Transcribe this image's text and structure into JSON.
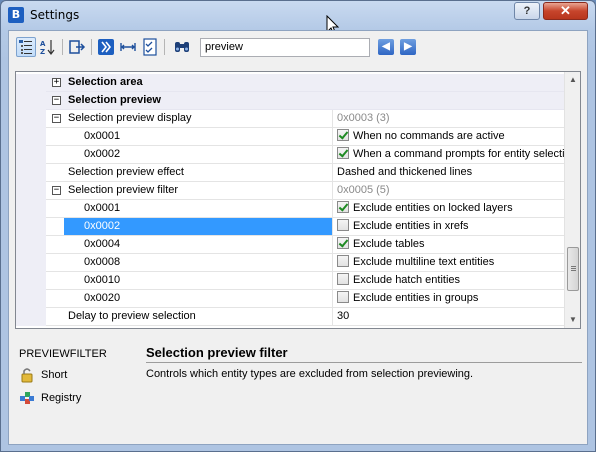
{
  "window": {
    "title": "Settings",
    "help_label": "?",
    "close_label": "✕"
  },
  "toolbar": {
    "search_value": "preview",
    "buttons": [
      "categorized-view-icon",
      "alphabetical-view-icon",
      "export-icon",
      "bricscad-icon",
      "width-icon",
      "checklist-icon",
      "binoculars-icon"
    ],
    "prev_label": "◀",
    "next_label": "▶"
  },
  "grid": {
    "rows": [
      {
        "kind": "category",
        "expander": "+",
        "name": "Selection area"
      },
      {
        "kind": "category",
        "expander": "−",
        "name": "Selection preview"
      },
      {
        "kind": "group",
        "expander": "−",
        "name": "Selection preview display",
        "value": "0x0003 (3)",
        "value_muted": true
      },
      {
        "kind": "item",
        "name": "0x0001",
        "checked": true,
        "value": "When no commands are active"
      },
      {
        "kind": "item",
        "name": "0x0002",
        "checked": true,
        "value": "When a command prompts for entity selection"
      },
      {
        "kind": "plain",
        "name": "Selection preview effect",
        "value": "Dashed and thickened lines"
      },
      {
        "kind": "group",
        "expander": "−",
        "name": "Selection preview filter",
        "value": "0x0005 (5)",
        "value_muted": true
      },
      {
        "kind": "item",
        "name": "0x0001",
        "checked": true,
        "value": "Exclude entities on locked layers"
      },
      {
        "kind": "item",
        "name": "0x0002",
        "checked": false,
        "value": "Exclude entities in xrefs",
        "selected": true
      },
      {
        "kind": "item",
        "name": "0x0004",
        "checked": true,
        "value": "Exclude tables"
      },
      {
        "kind": "item",
        "name": "0x0008",
        "checked": false,
        "value": "Exclude multiline text entities"
      },
      {
        "kind": "item",
        "name": "0x0010",
        "checked": false,
        "value": "Exclude hatch entities"
      },
      {
        "kind": "item",
        "name": "0x0020",
        "checked": false,
        "value": "Exclude entities in groups"
      },
      {
        "kind": "plain",
        "name": "Delay to preview selection",
        "value": "30"
      }
    ]
  },
  "help": {
    "command": "PREVIEWFILTER",
    "scope_short": "Short",
    "scope_registry": "Registry",
    "title": "Selection preview filter",
    "description": "Controls which entity types are excluded from selection previewing."
  },
  "colors": {
    "selection": "#3399ff",
    "category_bg": "#eeeef6",
    "check": "#1e8a22"
  }
}
